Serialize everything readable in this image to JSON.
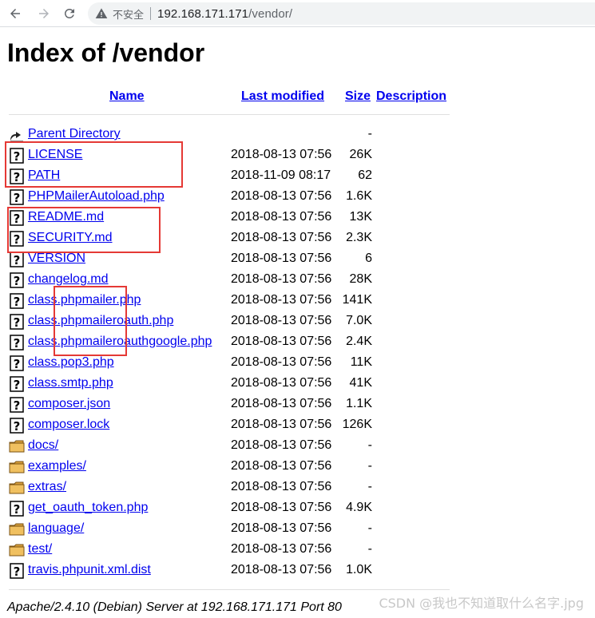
{
  "browser": {
    "insecure_label": "不安全",
    "url_host": "192.168.171.171",
    "url_path": "/vendor/"
  },
  "page": {
    "title": "Index of /vendor",
    "columns": {
      "name": "Name",
      "last_modified": "Last modified",
      "size": "Size",
      "description": "Description"
    },
    "parent_label": "Parent Directory",
    "parent_size": "-",
    "entries": [
      {
        "name": "LICENSE",
        "date": "2018-08-13 07:56",
        "size": "26K",
        "icon": "unknown-file-icon"
      },
      {
        "name": "PATH",
        "date": "2018-11-09 08:17",
        "size": "62",
        "icon": "unknown-file-icon"
      },
      {
        "name": "PHPMailerAutoload.php",
        "date": "2018-08-13 07:56",
        "size": "1.6K",
        "icon": "unknown-file-icon"
      },
      {
        "name": "README.md",
        "date": "2018-08-13 07:56",
        "size": "13K",
        "icon": "unknown-file-icon"
      },
      {
        "name": "SECURITY.md",
        "date": "2018-08-13 07:56",
        "size": "2.3K",
        "icon": "unknown-file-icon"
      },
      {
        "name": "VERSION",
        "date": "2018-08-13 07:56",
        "size": "6",
        "icon": "unknown-file-icon"
      },
      {
        "name": "changelog.md",
        "date": "2018-08-13 07:56",
        "size": "28K",
        "icon": "unknown-file-icon"
      },
      {
        "name": "class.phpmailer.php",
        "date": "2018-08-13 07:56",
        "size": "141K",
        "icon": "unknown-file-icon"
      },
      {
        "name": "class.phpmaileroauth.php",
        "date": "2018-08-13 07:56",
        "size": "7.0K",
        "icon": "unknown-file-icon"
      },
      {
        "name": "class.phpmaileroauthgoogle.php",
        "date": "2018-08-13 07:56",
        "size": "2.4K",
        "icon": "unknown-file-icon"
      },
      {
        "name": "class.pop3.php",
        "date": "2018-08-13 07:56",
        "size": "11K",
        "icon": "unknown-file-icon"
      },
      {
        "name": "class.smtp.php",
        "date": "2018-08-13 07:56",
        "size": "41K",
        "icon": "unknown-file-icon"
      },
      {
        "name": "composer.json",
        "date": "2018-08-13 07:56",
        "size": "1.1K",
        "icon": "unknown-file-icon"
      },
      {
        "name": "composer.lock",
        "date": "2018-08-13 07:56",
        "size": "126K",
        "icon": "unknown-file-icon"
      },
      {
        "name": "docs/",
        "date": "2018-08-13 07:56",
        "size": "-",
        "icon": "folder-icon"
      },
      {
        "name": "examples/",
        "date": "2018-08-13 07:56",
        "size": "-",
        "icon": "folder-icon"
      },
      {
        "name": "extras/",
        "date": "2018-08-13 07:56",
        "size": "-",
        "icon": "folder-icon"
      },
      {
        "name": "get_oauth_token.php",
        "date": "2018-08-13 07:56",
        "size": "4.9K",
        "icon": "unknown-file-icon"
      },
      {
        "name": "language/",
        "date": "2018-08-13 07:56",
        "size": "-",
        "icon": "folder-icon"
      },
      {
        "name": "test/",
        "date": "2018-08-13 07:56",
        "size": "-",
        "icon": "folder-icon"
      },
      {
        "name": "travis.phpunit.xml.dist",
        "date": "2018-08-13 07:56",
        "size": "1.0K",
        "icon": "unknown-file-icon"
      }
    ],
    "footer": "Apache/2.4.10 (Debian) Server at 192.168.171.171 Port 80",
    "watermark": "CSDN @我也不知道取什么名字.jpg"
  },
  "colors": {
    "link": "#0000ee",
    "visited_link": "#551a8b",
    "highlight_box": "#e53935"
  }
}
